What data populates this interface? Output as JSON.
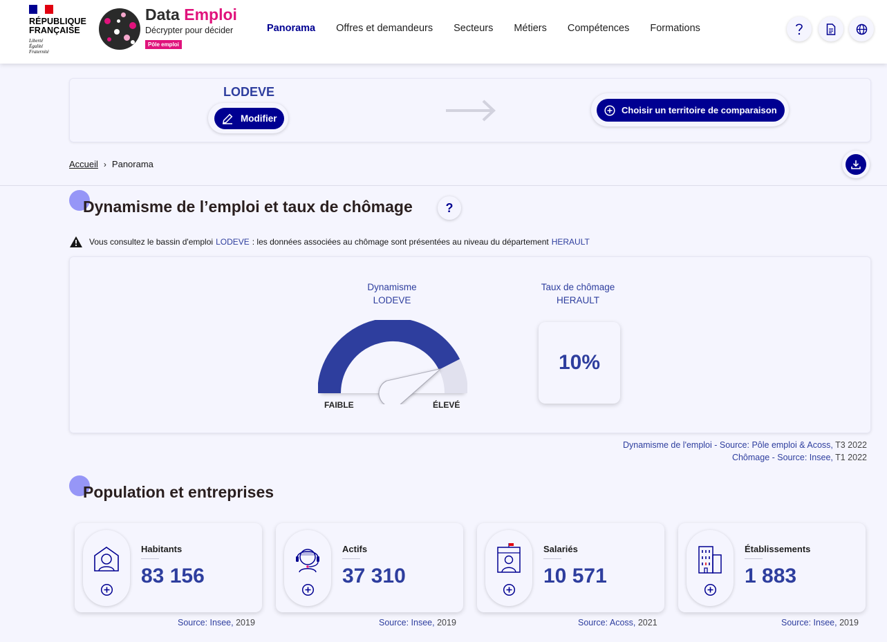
{
  "header": {
    "republique": {
      "line1": "RÉPUBLIQUE",
      "line2": "FRANÇAISE",
      "motto": [
        "Liberté",
        "Égalité",
        "Fraternité"
      ]
    },
    "brand": {
      "title_part1": "Data",
      "title_part2": "Emploi",
      "subtitle": "Décrypter pour décider",
      "badge": "Pôle emploi"
    },
    "nav": [
      {
        "label": "Panorama",
        "active": true
      },
      {
        "label": "Offres et demandeurs",
        "active": false
      },
      {
        "label": "Secteurs",
        "active": false
      },
      {
        "label": "Métiers",
        "active": false
      },
      {
        "label": "Compétences",
        "active": false
      },
      {
        "label": "Formations",
        "active": false
      }
    ],
    "icons": [
      "help-icon",
      "document-icon",
      "globe-icon"
    ]
  },
  "territory": {
    "name": "LODEVE",
    "modify_label": "Modifier",
    "compare_label": "Choisir un territoire de comparaison"
  },
  "breadcrumb": {
    "home": "Accueil",
    "separator": "›",
    "current": "Panorama"
  },
  "dynamism_section": {
    "title": "Dynamisme de l’emploi et taux de chômage",
    "help": "?",
    "warning": {
      "prefix": "Vous consultez le bassin d'emploi",
      "basin": "LODEVE",
      "middle": ": les données associées au chômage sont présentées au niveau du département",
      "department": "HERAULT"
    },
    "gauge": {
      "label_line1": "Dynamisme",
      "label_line2": "LODEVE",
      "low_label": "FAIBLE",
      "high_label": "ÉLEVÉ",
      "level": 0.85,
      "color": "#2e3e9e"
    },
    "rate": {
      "label_line1": "Taux de chômage",
      "label_line2": "HERAULT",
      "value": "10%"
    },
    "sources": [
      {
        "text": "Dynamisme de l'emploi - Source: Pôle emploi & Acoss,",
        "year": "T3 2022"
      },
      {
        "text": "Chômage - Source: Insee,",
        "year": "T1 2022"
      }
    ]
  },
  "population_section": {
    "title": "Population et entreprises",
    "cards": [
      {
        "label": "Habitants",
        "value": "83 156",
        "icon": "house-person-icon",
        "source": "Source: Insee,",
        "year": "2019"
      },
      {
        "label": "Actifs",
        "value": "37 310",
        "icon": "headset-person-icon",
        "source": "Source: Insee,",
        "year": "2019"
      },
      {
        "label": "Salariés",
        "value": "10 571",
        "icon": "building-person-icon",
        "source": "Source: Acoss,",
        "year": "2021"
      },
      {
        "label": "Établissements",
        "value": "1 883",
        "icon": "buildings-icon",
        "source": "Source: Insee,",
        "year": "2019"
      }
    ]
  },
  "colors": {
    "primary": "#000091",
    "accent": "#2e3e9e",
    "brand_pink": "#e0137c",
    "background": "#f5f5fe"
  }
}
